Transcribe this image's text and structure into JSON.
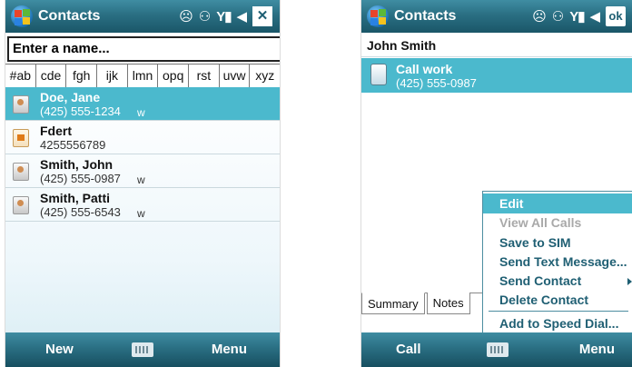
{
  "colors": {
    "titlebar": "#2a6f83",
    "selection": "#4bb9cd",
    "menu_text": "#1f5f73"
  },
  "left_screen": {
    "title": "Contacts",
    "close_label": "✕",
    "search_placeholder": "Enter a name...",
    "alpha_tabs": [
      "#ab",
      "cde",
      "fgh",
      "ijk",
      "lmn",
      "opq",
      "rst",
      "uvw",
      "xyz"
    ],
    "contacts": [
      {
        "name": "Doe, Jane",
        "number": "(425) 555-1234",
        "kind": "w",
        "icon": "contact-card-icon"
      },
      {
        "name": "Fdert",
        "number": "4255556789",
        "kind": "",
        "icon": "sim-card-icon"
      },
      {
        "name": "Smith, John",
        "number": "(425) 555-0987",
        "kind": "w",
        "icon": "contact-card-icon"
      },
      {
        "name": "Smith, Patti",
        "number": "(425) 555-6543",
        "kind": "w",
        "icon": "contact-card-icon"
      }
    ],
    "softkeys": {
      "left": "New",
      "right": "Menu"
    }
  },
  "right_screen": {
    "title": "Contacts",
    "ok_label": "ok",
    "contact_name": "John Smith",
    "call_label": "Call work",
    "call_number": "(425) 555-0987",
    "tabs": [
      "Summary",
      "Notes"
    ],
    "menu_items": [
      "Edit",
      "View All Calls",
      "Save to SIM",
      "Send Text Message...",
      "Send Contact",
      "Delete Contact",
      "Add to Speed Dial..."
    ],
    "softkeys": {
      "left": "Call",
      "right": "Menu"
    }
  }
}
